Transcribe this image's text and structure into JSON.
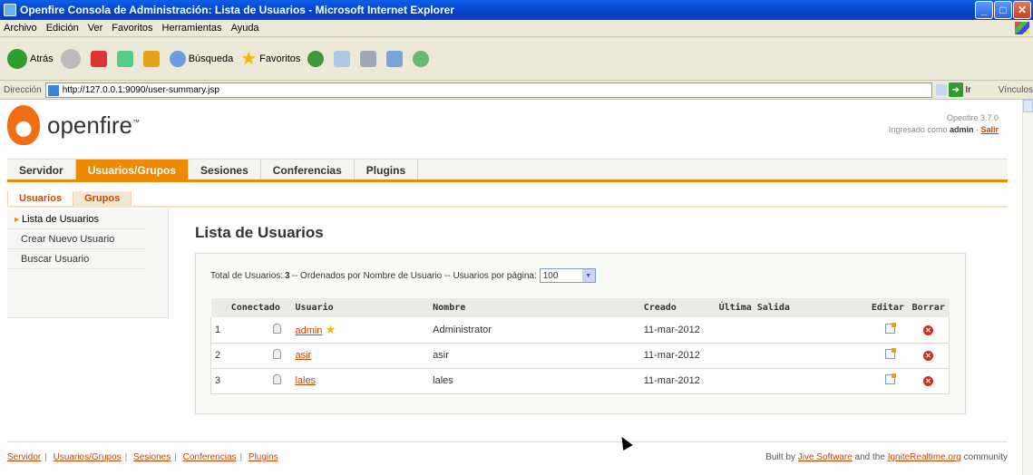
{
  "window": {
    "title": "Openfire Consola de Administración: Lista de Usuarios - Microsoft Internet Explorer"
  },
  "menubar": [
    "Archivo",
    "Edición",
    "Ver",
    "Favoritos",
    "Herramientas",
    "Ayuda"
  ],
  "toolbar": {
    "back": "Atrás",
    "search": "Búsqueda",
    "favorites": "Favoritos"
  },
  "address": {
    "label": "Dirección",
    "url": "http://127.0.0.1:9090/user-summary.jsp",
    "go": "Ir",
    "links": "Vínculos"
  },
  "header": {
    "brand": "openfire",
    "version": "Openfire 3.7.0",
    "logged_prefix": "Ingresado como",
    "user": "admin",
    "logout": "Salir"
  },
  "mainnav": [
    "Servidor",
    "Usuarios/Grupos",
    "Sesiones",
    "Conferencias",
    "Plugins"
  ],
  "subnav": [
    "Usuarios",
    "Grupos"
  ],
  "sidebar": [
    "Lista de Usuarios",
    "Crear Nuevo Usuario",
    "Buscar Usuario"
  ],
  "page": {
    "title": "Lista de Usuarios"
  },
  "summary": {
    "prefix": "Total de Usuarios:",
    "count": "3",
    "rest": "-- Ordenados por Nombre de Usuario -- Usuarios por página:",
    "per_page": "100"
  },
  "table": {
    "headers": [
      "",
      "Conectado",
      "Usuario",
      "Nombre",
      "Creado",
      "Última Salida",
      "Editar",
      "Borrar"
    ],
    "rows": [
      {
        "n": "1",
        "user": "admin",
        "name": "Administrator",
        "created": "11-mar-2012",
        "last": ""
      },
      {
        "n": "2",
        "user": "asir",
        "name": "asir",
        "created": "11-mar-2012",
        "last": ""
      },
      {
        "n": "3",
        "user": "lales",
        "name": "lales",
        "created": "11-mar-2012",
        "last": ""
      }
    ]
  },
  "footer": {
    "links": [
      "Servidor",
      "Usuarios/Grupos",
      "Sesiones",
      "Conferencias",
      "Plugins"
    ],
    "built_by": "Built by",
    "jive": "Jive Software",
    "and_the": "and the",
    "ignite": "IgniteRealtime.org",
    "community": "community"
  }
}
